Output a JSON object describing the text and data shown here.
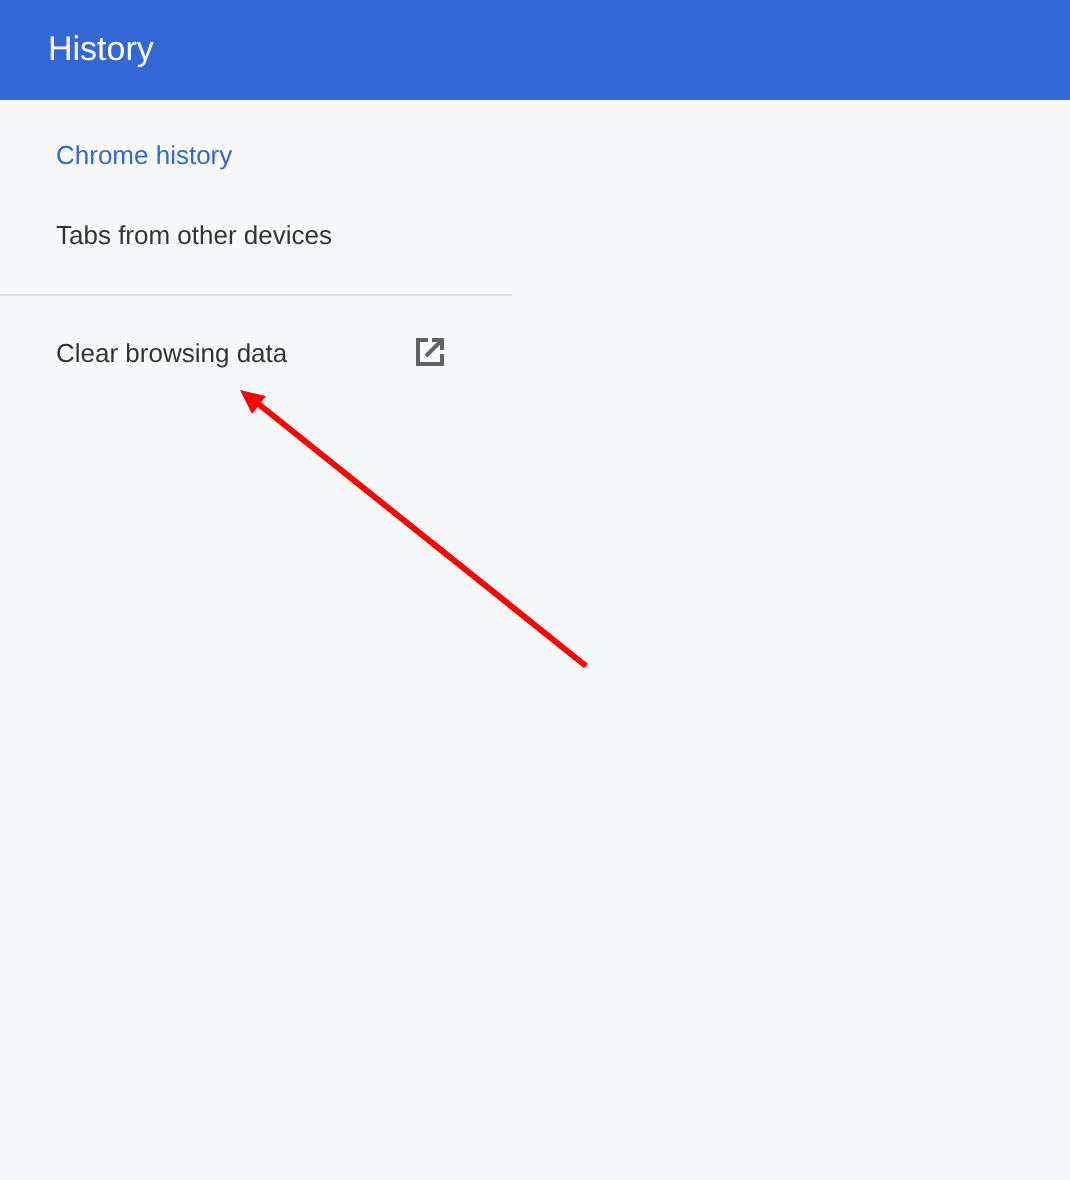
{
  "toolbar": {
    "title": "History"
  },
  "sidebar": {
    "items": [
      {
        "label": "Chrome history",
        "selected": true
      },
      {
        "label": "Tabs from other devices",
        "selected": false
      }
    ],
    "footer_item": {
      "label": "Clear browsing data"
    }
  },
  "annotation": {
    "kind": "arrow"
  }
}
